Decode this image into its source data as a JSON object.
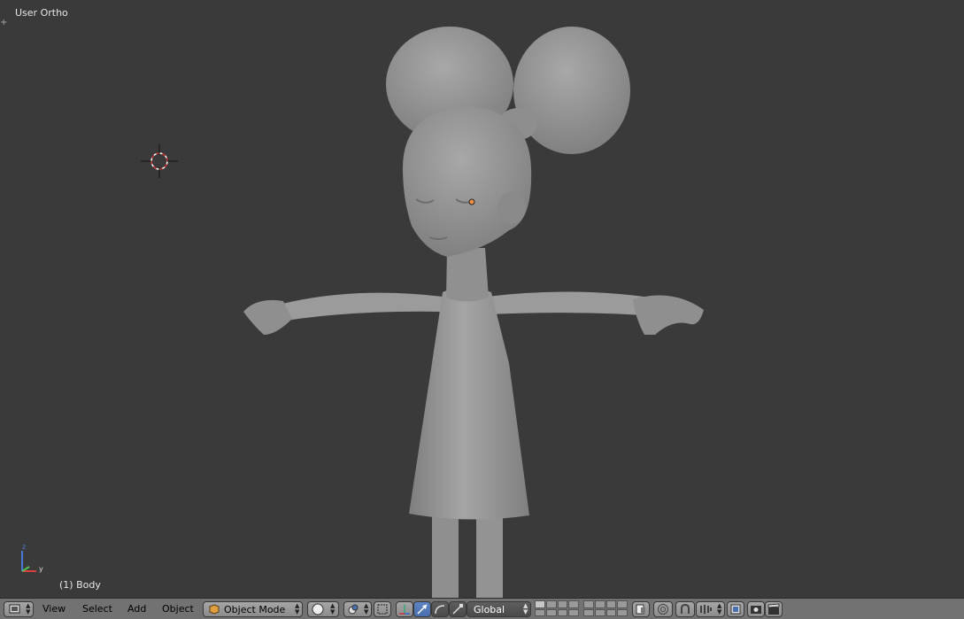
{
  "viewport": {
    "view_label": "User Ortho",
    "object_label": "(1) Body"
  },
  "header": {
    "menus": [
      "View",
      "Select",
      "Add",
      "Object"
    ],
    "mode_label": "Object Mode",
    "orientation_label": "Global"
  },
  "axes": {
    "x": "x",
    "y": "y",
    "z": "z"
  },
  "icons": [
    "editor-type-icon",
    "object-mode-cube-icon",
    "viewport-shading-icon",
    "pivot-icon",
    "manipulator-icon",
    "translate-icon",
    "rotate-icon",
    "scale-icon",
    "layers-grid",
    "render-icon"
  ]
}
